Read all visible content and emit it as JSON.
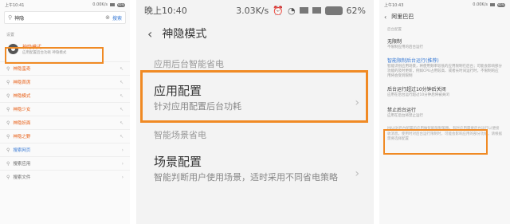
{
  "panel1": {
    "status": {
      "time": "上午10:41",
      "speed": "0.00K/s",
      "battery": "62%"
    },
    "search": {
      "query": "神隐",
      "clear_icon": "close-icon",
      "button": "搜索"
    },
    "section": "设置",
    "top_hit": {
      "title": "神隐模式",
      "subtitle": "应用配置后台功耗 神隐模式"
    },
    "suggestions": [
      {
        "label": "神隐蛮奇",
        "style": "orange"
      },
      {
        "label": "神隐首席",
        "style": "orange"
      },
      {
        "label": "神隐模式",
        "style": "orange"
      },
      {
        "label": "神隐少女",
        "style": "orange"
      },
      {
        "label": "神隐妖面",
        "style": "orange"
      },
      {
        "label": "神隐之野",
        "style": "orange"
      },
      {
        "label": "搜索网页",
        "style": "blue"
      },
      {
        "label": "搜索应用",
        "style": "gray"
      },
      {
        "label": "搜索文件",
        "style": "gray"
      }
    ]
  },
  "panel2": {
    "status": {
      "time": "晚上10:40",
      "speed": "3.03K/s",
      "battery": "62%"
    },
    "title": "神隐模式",
    "group1": "应用后台智能省电",
    "row1": {
      "title": "应用配置",
      "subtitle": "针对应用配置后台功耗"
    },
    "group2": "智能场景省电",
    "row2": {
      "title": "场景配置",
      "subtitle": "智能判断用户使用场景，适时采用不同省电策略"
    }
  },
  "panel3": {
    "status": {
      "time": "上午10:43",
      "speed": "0.00K/s",
      "battery": "62%"
    },
    "title": "阿里巴巴",
    "group": "后台配置",
    "options": [
      {
        "title": "无限制",
        "subtitle": "不限制应用的后台运行",
        "blue": false
      },
      {
        "title": "智能限制后台运行(推荐)",
        "subtitle": "智能识别应用场景，将使用频率较低的应用限制在后台；可能会影响部分功能的及时更新，例如CPU占用较高、或者长时间运行时，不限制的应用将会受到限制",
        "blue": true
      },
      {
        "title": "后台运行超过10分钟后关闭",
        "subtitle": "应用在后台运行超过10分钟后将被关闭",
        "blue": false
      },
      {
        "title": "禁止后台运行",
        "subtitle": "应用在后台将禁止运行",
        "blue": false
      }
    ],
    "note": "MIUI对后台配置的应用做智能限制策略。有时应用需要后台运行以便接收消息，使用时对后台运行限制时，可能会影响应用的部分功能，请根据需要选择配置"
  }
}
